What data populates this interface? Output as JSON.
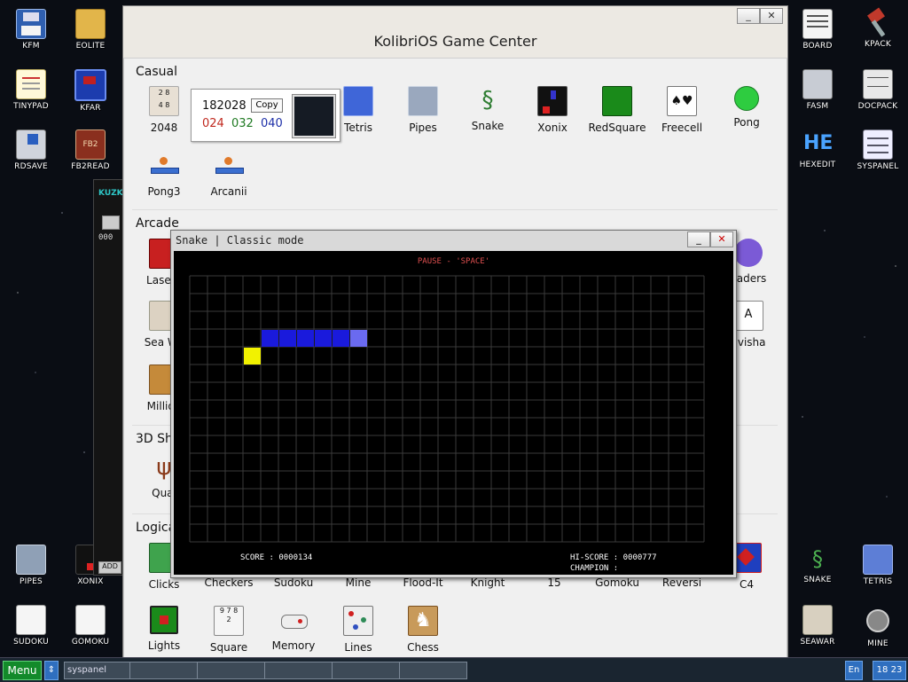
{
  "desktop_icons": [
    {
      "id": "kfm",
      "label": "KFM",
      "icon": "floppy-disk-icon"
    },
    {
      "id": "eolite",
      "label": "EOLITE",
      "icon": "folder-icon"
    },
    {
      "id": "tinypad",
      "label": "TINYPAD",
      "icon": "notepad-icon"
    },
    {
      "id": "kfar",
      "label": "KFAR",
      "icon": "kfar-icon"
    },
    {
      "id": "rdsave",
      "label": "RDSAVE",
      "icon": "rdsave-icon"
    },
    {
      "id": "fb2read",
      "label": "FB2READ",
      "icon": "fb2-book-icon"
    },
    {
      "id": "board",
      "label": "BOARD",
      "icon": "board-icon"
    },
    {
      "id": "kpack",
      "label": "KPACK",
      "icon": "hammer-icon"
    },
    {
      "id": "fasm",
      "label": "FASM",
      "icon": "fasm-icon"
    },
    {
      "id": "docpack",
      "label": "DOCPACK",
      "icon": "cabinet-icon"
    },
    {
      "id": "hexedit",
      "label": "HEXEDIT",
      "icon": "hexedit-icon"
    },
    {
      "id": "syspanel",
      "label": "SYSPANEL",
      "icon": "sliders-icon"
    },
    {
      "id": "pipes",
      "label": "PIPES",
      "icon": "pipes-icon"
    },
    {
      "id": "xonix",
      "label": "XONIX",
      "icon": "xonix-icon"
    },
    {
      "id": "sudoku",
      "label": "SUDOKU",
      "icon": "sudoku-icon"
    },
    {
      "id": "gomoku",
      "label": "GOMOKU",
      "icon": "gomoku-icon"
    },
    {
      "id": "snake",
      "label": "SNAKE",
      "icon": "snake-icon"
    },
    {
      "id": "tetris",
      "label": "TETRIS",
      "icon": "tetris-icon"
    },
    {
      "id": "seawar",
      "label": "SEAWAR",
      "icon": "ship-icon"
    },
    {
      "id": "mine",
      "label": "MINE",
      "icon": "mine-icon"
    }
  ],
  "left_window": {
    "label1": "KUZK",
    "label2": "000",
    "add_label": "ADD"
  },
  "game_center": {
    "title": "KolibriOS Game Center",
    "sections": {
      "casual": "Casual",
      "arcade": "Arcade",
      "shooters": "3D Sh",
      "logical": "Logica"
    },
    "casual_row1": [
      "2048",
      "Tetris",
      "Pipes",
      "Snake",
      "Xonix",
      "RedSquare",
      "Freecell",
      "Pong"
    ],
    "casual_row2": [
      "Pong3",
      "Arcanii"
    ],
    "arcade_visible": [
      "LaserT",
      "Sea Wa",
      "Million",
      "vaders",
      "avisha"
    ],
    "shooters_visible": [
      "Qual"
    ],
    "logical_row1": [
      "Clicks",
      "Checkers",
      "Sudoku",
      "Mine",
      "Flood-It",
      "Knight",
      "15",
      "Gomoku",
      "Reversi",
      "C4"
    ],
    "logical_row2": [
      "Lights",
      "Square",
      "Memory",
      "Lines",
      "Chess"
    ]
  },
  "color_picker": {
    "hex": "182028",
    "copy_label": "Copy",
    "r": "024",
    "g": "032",
    "b": "040",
    "swatch_color": "#182028"
  },
  "snake_window": {
    "title": "Snake | Classic mode",
    "pause_text": "PAUSE - 'SPACE'",
    "score_text": "SCORE : 0000134",
    "hiscore_text": "HI-SCORE : 0000777",
    "champion_text": "CHAMPION :",
    "colors": {
      "snake_body": "#1a1adc",
      "snake_head": "#6a6af0",
      "food": "#f2f200",
      "grid": "#3a3a3a",
      "pause": "#e05050"
    }
  },
  "taskbar": {
    "menu_label": "Menu",
    "task_label": "syspanel",
    "lang": "En",
    "clock": "18 23"
  }
}
